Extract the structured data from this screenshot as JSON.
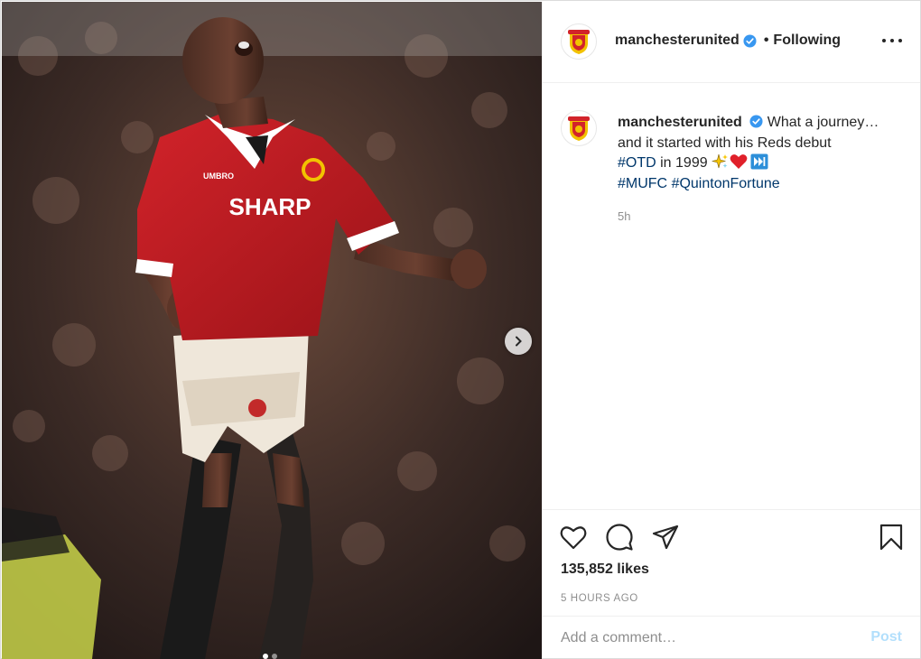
{
  "post": {
    "image_alt": "Player in red SHARP shirt celebrating with fists clenched",
    "shirt_text": "SHARP",
    "shirt_brand": "UMBRO",
    "carousel_total": 2,
    "carousel_active": 0
  },
  "header": {
    "username": "manchesterunited",
    "separator": "•",
    "follow_label": "Following"
  },
  "caption": {
    "username": "manchesterunited",
    "text_1": "What a journey…",
    "text_2": "and it started with his Reds debut",
    "hashtag_otd": "#OTD",
    "text_3": " in 1999 ",
    "hashtag_mufc": "#MUFC",
    "hashtag_player": "#QuintonFortune",
    "relative_time": "5h",
    "emojis": [
      "sparkles-icon",
      "red-heart-icon",
      "fast-forward-icon"
    ]
  },
  "actions": {
    "like_icon": "heart-icon",
    "comment_icon": "speech-bubble-icon",
    "share_icon": "paper-plane-icon",
    "save_icon": "bookmark-icon"
  },
  "stats": {
    "likes": "135,852 likes",
    "posted": "5 HOURS AGO"
  },
  "comment": {
    "placeholder": "Add a comment…",
    "post_label": "Post"
  },
  "colors": {
    "verified": "#3897f0",
    "hashtag": "#00376b",
    "post_disabled": "#b2dffc",
    "muted": "#8e8e8e"
  }
}
